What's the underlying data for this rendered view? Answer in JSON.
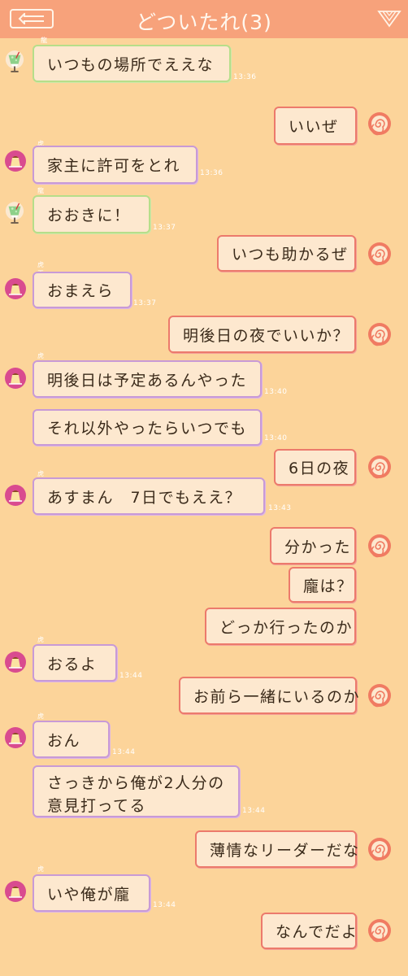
{
  "header": {
    "title": "どついたれ(3)"
  },
  "messages": [
    {
      "text": "いつもの場所でええな",
      "time": "13:36",
      "sender": "龍"
    },
    {
      "text": "いいぜ"
    },
    {
      "text": "家主に許可をとれ",
      "time": "13:36",
      "sender": "虎王"
    },
    {
      "text": "おおきに！",
      "time": "13:37",
      "sender": "龍"
    },
    {
      "text": "いつも助かるぜ"
    },
    {
      "text": "おまえら",
      "time": "13:37",
      "sender": "虎王"
    },
    {
      "text": "明後日の夜でいいか？"
    },
    {
      "text": "明後日は予定あるんやった",
      "time": "13:40",
      "sender": "虎王"
    },
    {
      "text": "それ以外やったらいつでも",
      "time": "13:40"
    },
    {
      "text": "6日の夜"
    },
    {
      "text": "あすまん　7日でもええ？",
      "time": "13:43",
      "sender": "虎王"
    },
    {
      "text": "分かった"
    },
    {
      "text": "龐は？"
    },
    {
      "text": "どっか行ったのか"
    },
    {
      "text": "おるよ",
      "time": "13:44",
      "sender": "虎王"
    },
    {
      "text": "お前ら一緒にいるのか"
    },
    {
      "text": "おん",
      "time": "13:44",
      "sender": "虎王"
    },
    {
      "line1": "さっきから俺が2人分の",
      "line2": "意見打ってる",
      "time": "13:44"
    },
    {
      "text": "薄情なリーダーだな"
    },
    {
      "text": "いや俺が龐",
      "time": "13:44",
      "sender": "虎王"
    },
    {
      "text": "なんでだよ"
    }
  ],
  "colors": {
    "header": "#f7a27b",
    "background": "#fcd49a",
    "green": "#b6de8a",
    "purple": "#c89ad6",
    "red": "#ec7a6c"
  },
  "icons": {
    "back": "back-arrow-icon",
    "menu": "triangle-menu-icon",
    "self": "swirl-icon",
    "melon": "cream-soda-icon",
    "pudding": "pudding-icon"
  }
}
